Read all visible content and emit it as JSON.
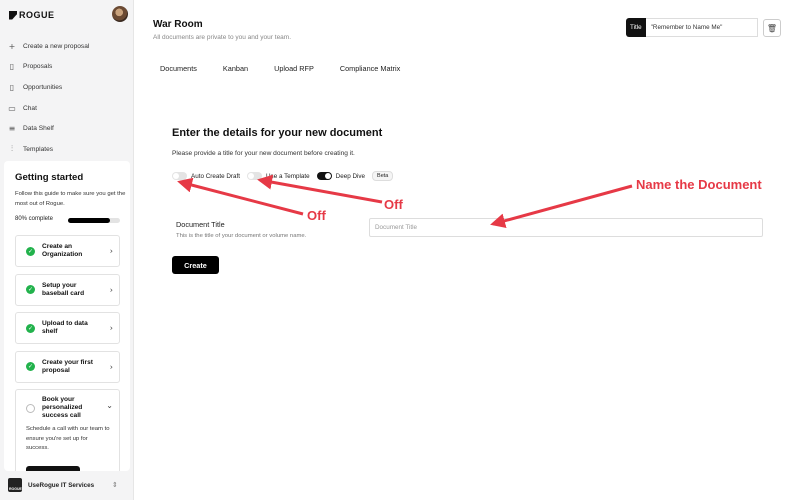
{
  "brand": {
    "logo_text": "ROGUE"
  },
  "sidebar": {
    "items": [
      {
        "label": "Create a new proposal",
        "icon": "plus-icon"
      },
      {
        "label": "Proposals",
        "icon": "document-icon"
      },
      {
        "label": "Opportunities",
        "icon": "document-icon"
      },
      {
        "label": "Chat",
        "icon": "chat-icon"
      },
      {
        "label": "Data Shelf",
        "icon": "database-icon"
      },
      {
        "label": "Templates",
        "icon": "sliders-icon"
      }
    ],
    "getting_started": {
      "title": "Getting started",
      "description": "Follow this guide to make sure you get the most out of Rogue.",
      "progress_label": "80% complete",
      "progress": 0.8,
      "steps": [
        {
          "label": "Create an Organization",
          "done": true
        },
        {
          "label": "Setup your baseball card",
          "done": true
        },
        {
          "label": "Upload to data shelf",
          "done": true
        },
        {
          "label": "Create your first proposal",
          "done": true
        },
        {
          "label": "Book your personalized success call",
          "done": false,
          "description": "Schedule a call with our team to ensure you're set up for success."
        }
      ]
    },
    "org": {
      "name": "UseRogue IT Services",
      "logo_text": "ROGUE"
    }
  },
  "header": {
    "title": "War Room",
    "subtitle": "All documents are private to you and your team.",
    "title_tag": "Title",
    "title_value": "\"Remember to Name Me\""
  },
  "tabs": [
    "Documents",
    "Kanban",
    "Upload RFP",
    "Compliance Matrix"
  ],
  "form": {
    "heading": "Enter the details for your new document",
    "description": "Please provide a title for your new document before creating it.",
    "toggles": [
      {
        "label": "Auto Create Draft",
        "on": false
      },
      {
        "label": "Use a Template",
        "on": false
      },
      {
        "label": "Deep Dive",
        "on": true,
        "badge": "Beta"
      }
    ],
    "field_label": "Document Title",
    "field_help": "This is the title of your document or volume name.",
    "field_placeholder": "Document Title",
    "create_label": "Create"
  },
  "annotations": {
    "name_doc": "Name the Document",
    "off_1": "Off",
    "off_2": "Off",
    "color": "#e63946"
  }
}
